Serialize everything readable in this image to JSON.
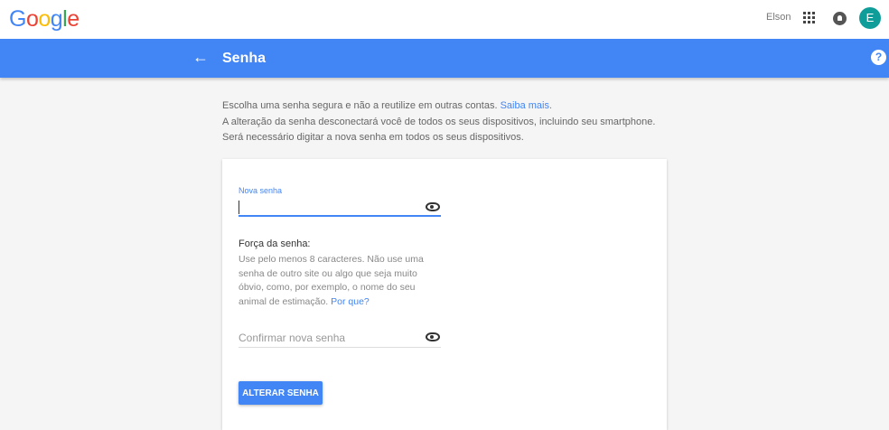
{
  "header": {
    "logo": "Google",
    "logo_colors": [
      "#4285f4",
      "#ea4335",
      "#fbbc05",
      "#4285f4",
      "#34a853",
      "#ea4335"
    ],
    "user_name": "Elson",
    "avatar_letter": "E"
  },
  "appbar": {
    "title": "Senha",
    "accent": "#4285f4"
  },
  "intro": {
    "line1": "Escolha uma senha segura e não a reutilize em outras contas.",
    "learn_more": "Saiba mais.",
    "line2": "A alteração da senha desconectará você de todos os seus dispositivos, incluindo seu smartphone. Será necessário digitar a nova senha em todos os seus dispositivos."
  },
  "form": {
    "new_password_label": "Nova senha",
    "new_password_value": "",
    "strength_title": "Força da senha:",
    "strength_hint": "Use pelo menos 8 caracteres. Não use uma senha de outro site ou algo que seja muito óbvio, como, por exemplo, o nome do seu animal de estimação.",
    "why_link": "Por que?",
    "confirm_placeholder": "Confirmar nova senha",
    "submit_label": "ALTERAR SENHA"
  }
}
